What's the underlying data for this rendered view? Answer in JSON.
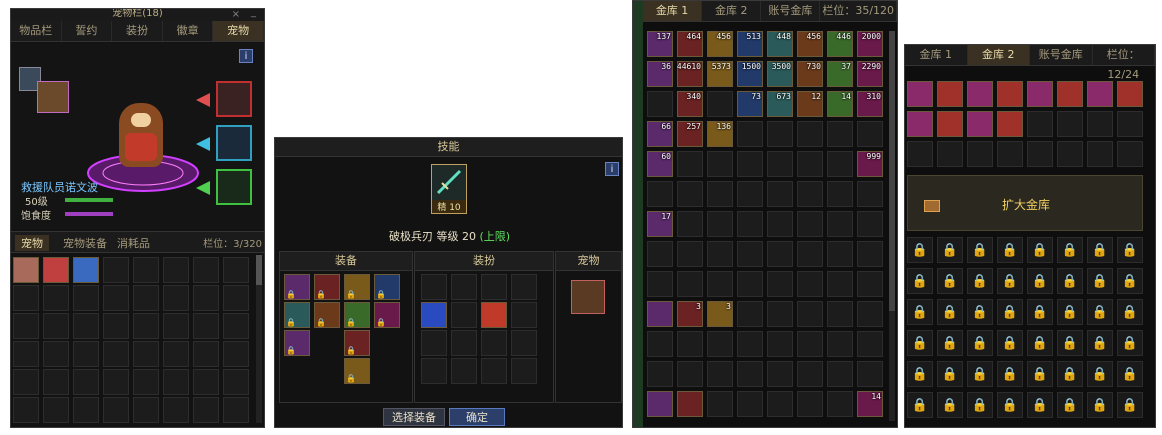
{
  "pet_window": {
    "title": "宠物栏(18)",
    "tabs": [
      "物品栏",
      "誓约",
      "装扮",
      "徽章",
      "宠物"
    ],
    "active_tab": 4,
    "pet_name": "救援队员诺文波",
    "pet_level": "50级",
    "satiety_label": "饱食度",
    "subtabs": [
      "宠物",
      "宠物装备",
      "消耗品"
    ],
    "slots_label": "栏位：3/320",
    "info_icon": "i"
  },
  "skill_window": {
    "title": "技能",
    "skill_rank": "精 10",
    "skill_desc_name": "破极兵刃 等级 20",
    "skill_desc_limit": "(上限)",
    "col_equip": "装备",
    "col_outfit": "装扮",
    "col_pet": "宠物",
    "btn_select": "选择装备",
    "btn_confirm": "确定",
    "info_icon": "i"
  },
  "gold_vault": {
    "tabs": [
      "金库 1",
      "金库 2",
      "账号金库"
    ],
    "active_tab": 0,
    "slots_label": "栏位：35/120",
    "counts": [
      "137",
      "464",
      "456",
      "513",
      "448",
      "456",
      "446",
      "2000",
      "36",
      "44610",
      "5373",
      "1500",
      "3500",
      "730",
      "37",
      "2290",
      "340",
      "73",
      "673",
      "12",
      "14",
      "310",
      "66",
      "257",
      "136",
      "60",
      "999",
      "17",
      "3",
      "3",
      "14"
    ]
  },
  "vault2": {
    "tabs": [
      "金库 1",
      "金库 2",
      "账号金库"
    ],
    "active_tab": 1,
    "slots_label": "栏位：12/24",
    "expand_label": "扩大金库"
  }
}
